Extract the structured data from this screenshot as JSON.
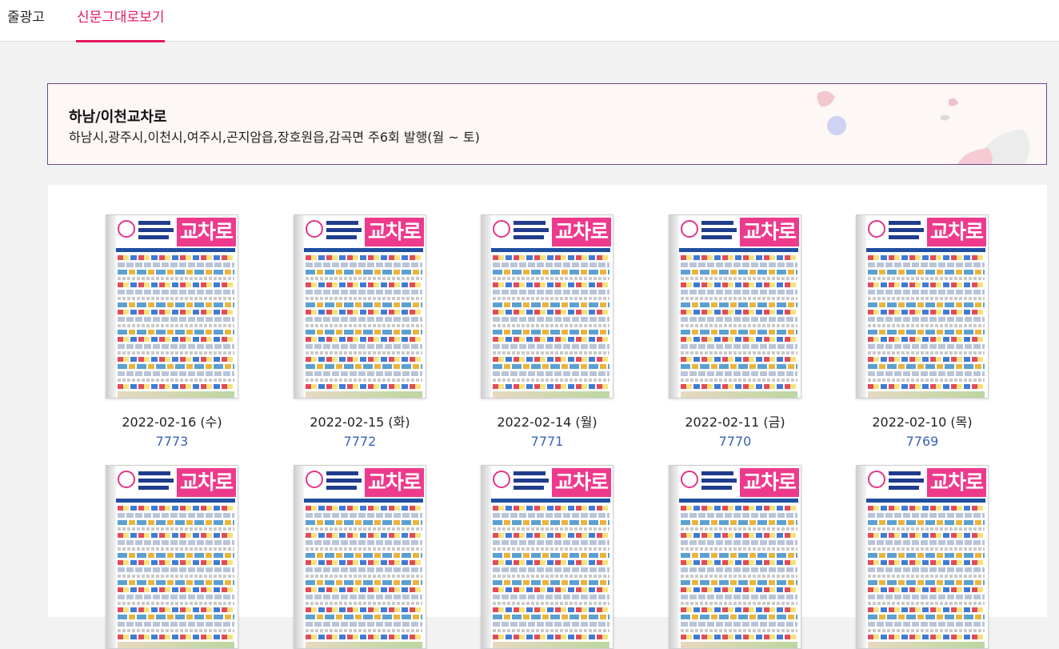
{
  "tabs": [
    {
      "label": "줄광고"
    },
    {
      "label": "신문그대로보기"
    }
  ],
  "banner": {
    "title": "하남/이천교차로",
    "description": "하남시,광주시,이천시,여주시,곤지암읍,장호원읍,감곡면 주6회 발행(월 ~ 토)"
  },
  "colors": {
    "accent": "#e6195a",
    "link": "#3a62b8",
    "banner_border": "#6a4a8a",
    "masthead": "#ee3a8c"
  },
  "issues": [
    {
      "date": "2022-02-16 (수)",
      "number": "7773",
      "masthead": "교차로"
    },
    {
      "date": "2022-02-15 (화)",
      "number": "7772",
      "masthead": "교차로"
    },
    {
      "date": "2022-02-14 (월)",
      "number": "7771",
      "masthead": "교차로"
    },
    {
      "date": "2022-02-11 (금)",
      "number": "7770",
      "masthead": "교차로"
    },
    {
      "date": "2022-02-10 (목)",
      "number": "7769",
      "masthead": "교차로"
    },
    {
      "masthead": "교차로"
    },
    {
      "masthead": "교차로"
    },
    {
      "masthead": "교차로"
    },
    {
      "masthead": "교차로"
    },
    {
      "masthead": "교차로"
    }
  ]
}
